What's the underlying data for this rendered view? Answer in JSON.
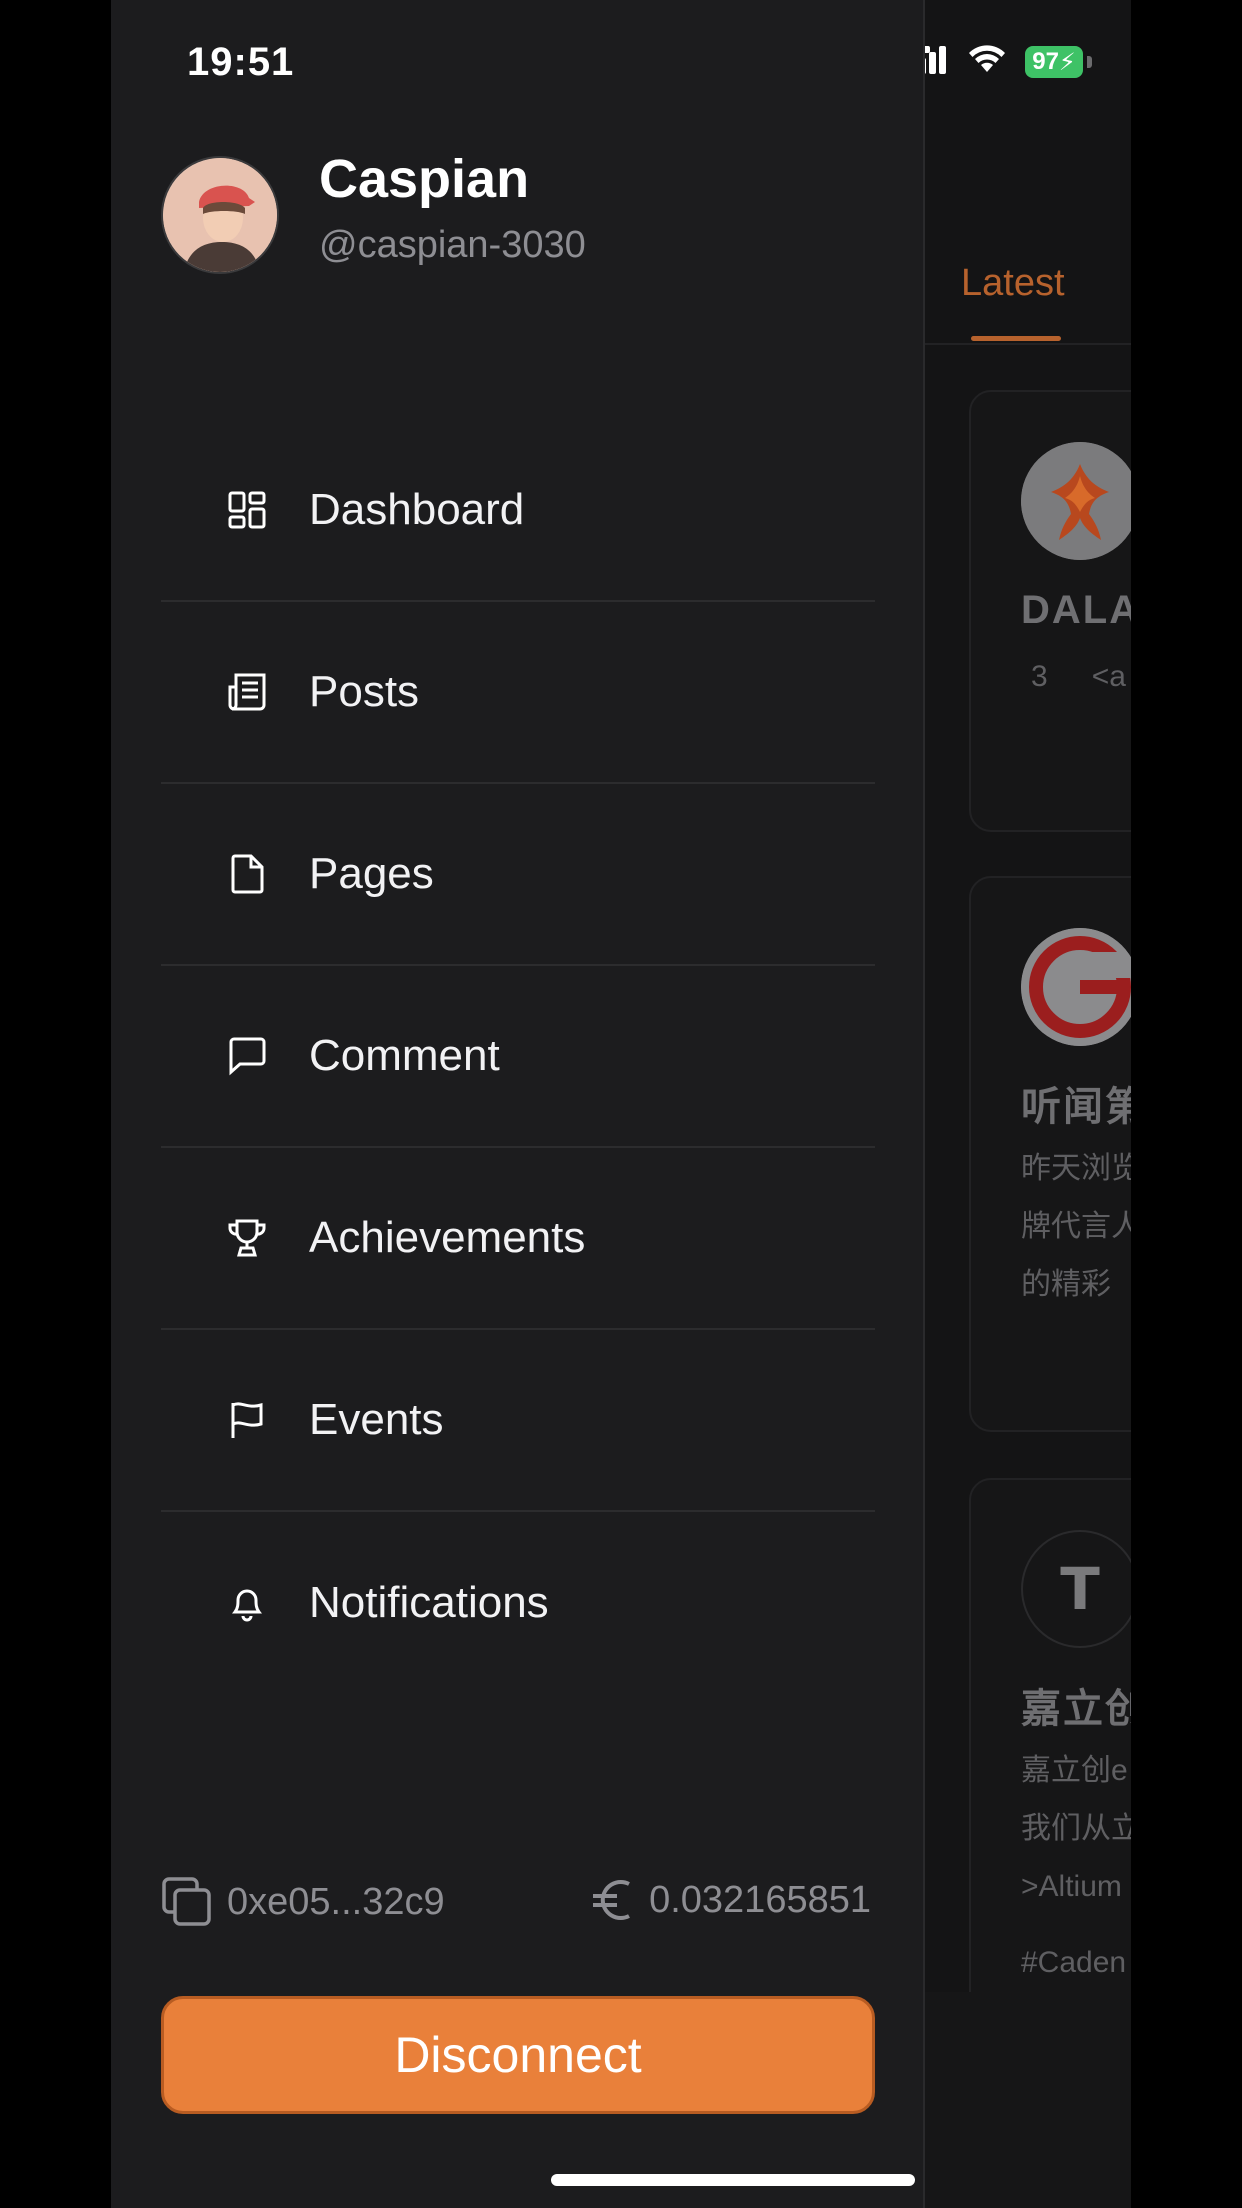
{
  "status_bar": {
    "time": "19:51",
    "battery": "97"
  },
  "profile": {
    "name": "Caspian",
    "handle": "@caspian-3030"
  },
  "menu": {
    "items": [
      {
        "label": "Dashboard",
        "icon": "dashboard-icon"
      },
      {
        "label": "Posts",
        "icon": "newspaper-icon"
      },
      {
        "label": "Pages",
        "icon": "file-icon"
      },
      {
        "label": "Comment",
        "icon": "comment-icon"
      },
      {
        "label": "Achievements",
        "icon": "trophy-icon"
      },
      {
        "label": "Events",
        "icon": "flag-icon"
      },
      {
        "label": "Notifications",
        "icon": "bell-icon"
      }
    ]
  },
  "wallet": {
    "address": "0xe05...32c9",
    "balance": "0.032165851"
  },
  "disconnect_label": "Disconnect",
  "background": {
    "tab_label": "Latest",
    "cards": [
      {
        "title": "DALA",
        "meta": [
          "3",
          "<a"
        ]
      },
      {
        "title": "听闻第",
        "lines": [
          "昨天浏览",
          "牌代言人",
          "的精彩"
        ]
      },
      {
        "avatar_letter": "T",
        "title": "嘉立创",
        "lines": [
          "嘉立创e",
          "我们从立",
          ">Altium"
        ],
        "tag": "#Caden"
      }
    ]
  },
  "colors": {
    "accent": "#e9803a",
    "drawer_bg": "#1c1c1e",
    "battery": "#3ec266"
  }
}
